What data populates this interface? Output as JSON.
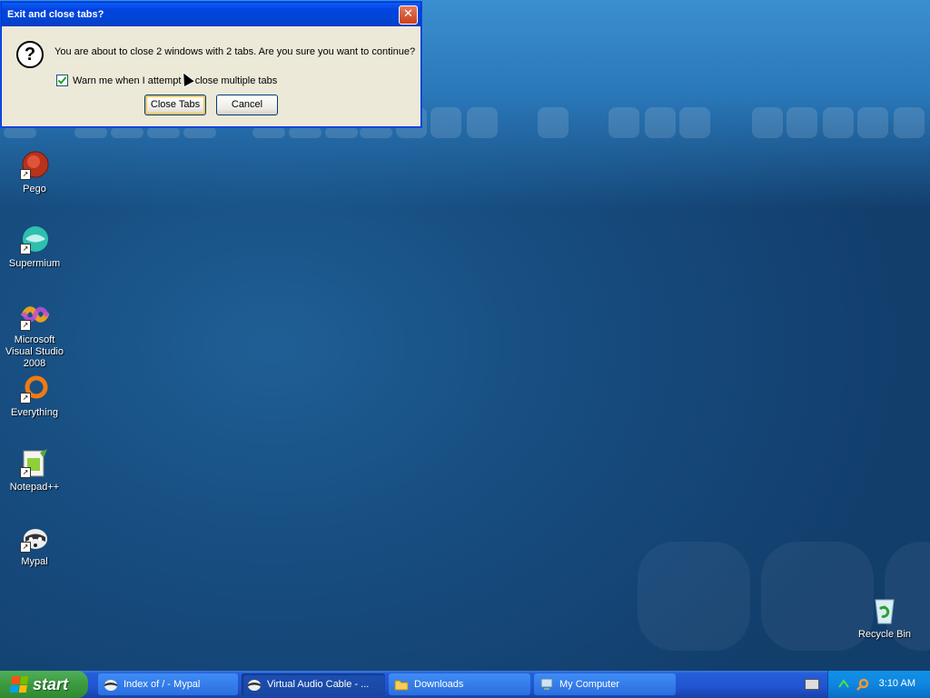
{
  "dialog": {
    "title": "Exit and close tabs?",
    "close_glyph": "✕",
    "question_glyph": "?",
    "message": "You are about to close 2 windows with 2 tabs. Are you sure you want to continue?",
    "checkbox_label": "Warn me when I attempt to close multiple tabs",
    "checkbox_checked": true,
    "close_tabs_label": "Close Tabs",
    "cancel_label": "Cancel"
  },
  "desktop_icons": [
    {
      "label": "Pego",
      "icon": "pego-icon"
    },
    {
      "label": "Supermium",
      "icon": "supermium-icon"
    },
    {
      "label": "Microsoft Visual Studio 2008",
      "icon": "visual-studio-icon"
    },
    {
      "label": "Everything",
      "icon": "everything-icon"
    },
    {
      "label": "Notepad++",
      "icon": "notepad-plus-plus-icon"
    },
    {
      "label": "Mypal",
      "icon": "mypal-icon"
    },
    {
      "label": "Recycle Bin",
      "icon": "recycle-bin-icon"
    }
  ],
  "taskbar": {
    "start_label": "start",
    "tasks": [
      {
        "label": "Index of / - Mypal",
        "icon": "mypal-icon",
        "active": false
      },
      {
        "label": "Virtual Audio Cable - ...",
        "icon": "mypal-icon",
        "active": true
      },
      {
        "label": "Downloads",
        "icon": "folder-icon",
        "active": false
      },
      {
        "label": "My Computer",
        "icon": "computer-icon",
        "active": false
      }
    ],
    "clock": "3:10 AM"
  },
  "colors": {
    "titlebar": "#0046d5",
    "taskbar": "#245edb",
    "start_button": "#3c9a3f",
    "desktop": "#164a7d"
  }
}
